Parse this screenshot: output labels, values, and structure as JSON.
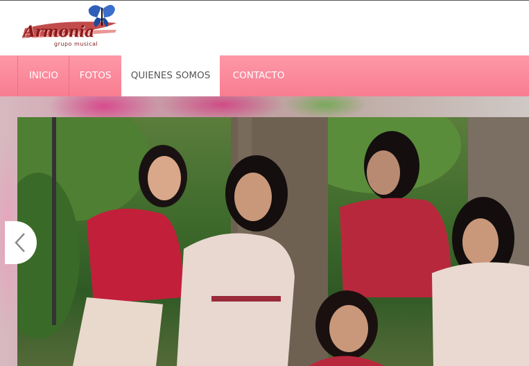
{
  "brand": {
    "logo_text": "Armonia",
    "logo_subtext": "grupo musical"
  },
  "nav": {
    "items": [
      {
        "label": "INICIO"
      },
      {
        "label": "FOTOS"
      },
      {
        "label": "QUIENES SOMOS",
        "active": true
      },
      {
        "label": "CONTACTO"
      }
    ]
  },
  "slider": {
    "prev_icon": "chevron-left-icon"
  },
  "colors": {
    "nav_bg": "#f98b9c",
    "accent": "#8a1a1a"
  }
}
